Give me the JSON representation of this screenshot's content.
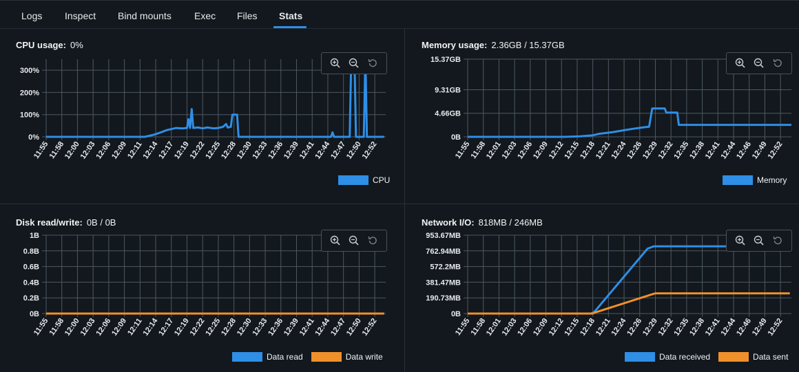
{
  "tabs": [
    {
      "label": "Logs",
      "active": false
    },
    {
      "label": "Inspect",
      "active": false
    },
    {
      "label": "Bind mounts",
      "active": false
    },
    {
      "label": "Exec",
      "active": false
    },
    {
      "label": "Files",
      "active": false
    },
    {
      "label": "Stats",
      "active": true
    }
  ],
  "colors": {
    "accent": "#2f8ee5",
    "series_blue": "#2f8ee5",
    "series_orange": "#f0902a",
    "grid": "#4e5964",
    "background": "#12181d"
  },
  "icons": [
    "zoom-in-icon",
    "zoom-out-icon",
    "reset-zoom-icon"
  ],
  "panels": {
    "cpu": {
      "title": "CPU usage:",
      "value": "0%"
    },
    "memory": {
      "title": "Memory usage:",
      "value": "2.36GB / 15.37GB"
    },
    "disk": {
      "title": "Disk read/write:",
      "value": "0B / 0B"
    },
    "network": {
      "title": "Network I/O:",
      "value": "818MB / 246MB"
    }
  },
  "chart_data": [
    {
      "id": "cpu",
      "type": "line",
      "x_ticks": [
        "11:55",
        "11:58",
        "12:00",
        "12:03",
        "12:06",
        "12:09",
        "12:11",
        "12:14",
        "12:17",
        "12:19",
        "12:22",
        "12:25",
        "12:28",
        "12:30",
        "12:33",
        "12:36",
        "12:39",
        "12:41",
        "12:44",
        "12:47",
        "12:50",
        "12:52"
      ],
      "y_ticks": [
        "0%",
        "100%",
        "200%",
        "300%"
      ],
      "ylim": [
        0,
        350
      ],
      "series": [
        {
          "name": "CPU",
          "color": "#2f8ee5",
          "points": [
            [
              0,
              0
            ],
            [
              6.3,
              0
            ],
            [
              6.9,
              10
            ],
            [
              7.4,
              22
            ],
            [
              7.7,
              30
            ],
            [
              8.3,
              40
            ],
            [
              8.7,
              38
            ],
            [
              9.0,
              40
            ],
            [
              9.1,
              80
            ],
            [
              9.2,
              40
            ],
            [
              9.3,
              125
            ],
            [
              9.4,
              40
            ],
            [
              9.7,
              42
            ],
            [
              10.0,
              38
            ],
            [
              10.3,
              42
            ],
            [
              10.7,
              38
            ],
            [
              11.0,
              40
            ],
            [
              11.3,
              45
            ],
            [
              11.5,
              58
            ],
            [
              11.6,
              42
            ],
            [
              11.8,
              45
            ],
            [
              11.9,
              100
            ],
            [
              12.2,
              100
            ],
            [
              12.3,
              0
            ],
            [
              18.2,
              0
            ],
            [
              18.3,
              20
            ],
            [
              18.4,
              0
            ],
            [
              19.4,
              0
            ],
            [
              19.5,
              360
            ],
            [
              19.7,
              360
            ],
            [
              19.8,
              0
            ],
            [
              20.3,
              0
            ],
            [
              20.4,
              360
            ],
            [
              20.5,
              0
            ],
            [
              21.6,
              0
            ]
          ]
        }
      ]
    },
    {
      "id": "memory",
      "type": "line",
      "x_ticks": [
        "11:55",
        "11:58",
        "12:01",
        "12:03",
        "12:06",
        "12:09",
        "12:12",
        "12:15",
        "12:18",
        "12:21",
        "12:24",
        "12:26",
        "12:29",
        "12:32",
        "12:35",
        "12:38",
        "12:41",
        "12:44",
        "12:46",
        "12:49",
        "12:52"
      ],
      "y_ticks": [
        "0B",
        "4.66GB",
        "9.31GB",
        "15.37GB"
      ],
      "ylim": [
        0,
        15.37
      ],
      "series": [
        {
          "name": "Memory",
          "color": "#2f8ee5",
          "points": [
            [
              0,
              0
            ],
            [
              6.2,
              0
            ],
            [
              7.2,
              0.1
            ],
            [
              8.0,
              0.3
            ],
            [
              8.4,
              0.6
            ],
            [
              9.2,
              0.9
            ],
            [
              10.0,
              1.3
            ],
            [
              10.6,
              1.6
            ],
            [
              11.3,
              1.9
            ],
            [
              11.6,
              2.0
            ],
            [
              11.8,
              5.6
            ],
            [
              12.6,
              5.6
            ],
            [
              12.7,
              4.8
            ],
            [
              13.4,
              4.8
            ],
            [
              13.5,
              2.36
            ],
            [
              20.7,
              2.36
            ]
          ]
        }
      ]
    },
    {
      "id": "disk",
      "type": "line",
      "x_ticks": [
        "11:55",
        "11:58",
        "12:00",
        "12:03",
        "12:06",
        "12:09",
        "12:11",
        "12:14",
        "12:17",
        "12:19",
        "12:22",
        "12:25",
        "12:28",
        "12:30",
        "12:33",
        "12:36",
        "12:39",
        "12:41",
        "12:44",
        "12:47",
        "12:50",
        "12:52"
      ],
      "y_ticks": [
        "0B",
        "0.2B",
        "0.4B",
        "0.6B",
        "0.8B",
        "1B"
      ],
      "ylim": [
        0,
        1
      ],
      "series": [
        {
          "name": "Data read",
          "color": "#2f8ee5",
          "points": [
            [
              0,
              0
            ],
            [
              21.6,
              0
            ]
          ]
        },
        {
          "name": "Data write",
          "color": "#f0902a",
          "points": [
            [
              0,
              0
            ],
            [
              21.6,
              0
            ]
          ]
        }
      ]
    },
    {
      "id": "network",
      "type": "line",
      "x_ticks": [
        "11:55",
        "11:58",
        "12:01",
        "12:03",
        "12:06",
        "12:09",
        "12:12",
        "12:15",
        "12:18",
        "12:21",
        "12:24",
        "12:26",
        "12:29",
        "12:32",
        "12:35",
        "12:38",
        "12:41",
        "12:44",
        "12:46",
        "12:49",
        "12:52"
      ],
      "y_ticks": [
        "0B",
        "190.73MB",
        "381.47MB",
        "572.2MB",
        "762.94MB",
        "953.67MB"
      ],
      "ylim": [
        0,
        953.67
      ],
      "series": [
        {
          "name": "Data received",
          "color": "#2f8ee5",
          "points": [
            [
              0,
              0
            ],
            [
              7.9,
              0
            ],
            [
              8.1,
              20
            ],
            [
              11.5,
              790
            ],
            [
              11.9,
              818
            ],
            [
              17.6,
              818
            ]
          ]
        },
        {
          "name": "Data sent",
          "color": "#f0902a",
          "points": [
            [
              0,
              0
            ],
            [
              8.0,
              0
            ],
            [
              8.1,
              10
            ],
            [
              11.8,
              235
            ],
            [
              12.0,
              246
            ],
            [
              20.6,
              246
            ]
          ]
        }
      ]
    }
  ]
}
